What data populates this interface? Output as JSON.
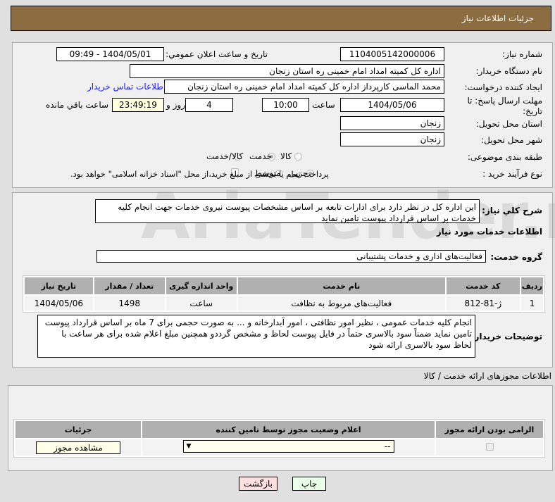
{
  "header": {
    "title": "جزئیات اطلاعات نیاز"
  },
  "watermark": "AriaTender.net",
  "info": {
    "need_number_label": "شماره نیاز:",
    "need_number": "1104005142000006",
    "announce_label": "تاریخ و ساعت اعلان عمومي:",
    "announce_value": "1404/05/01 - 09:49",
    "buyer_label": "نام دستگاه خریدار:",
    "buyer_value": "اداره کل کمیته امداد امام خمینی  ره  استان زنجان",
    "creator_label": "ایجاد کننده درخواست:",
    "creator_value": "محمد الماسی کارپرداز اداره کل کمیته امداد امام خمینی  ره  استان زنجان",
    "contact_link": "اطلاعات تماس خریدار",
    "deadline_label": "مهلت ارسال پاسخ: تا تاریخ:",
    "deadline_date": "1404/05/06",
    "time_label": "ساعت",
    "deadline_time": "10:00",
    "days": "4",
    "days_label": "روز و",
    "remaining": "23:49:19",
    "remaining_label": "ساعت باقي مانده",
    "province_label": "استان محل تحویل:",
    "province": "زنجان",
    "city_label": "شهر محل تحویل:",
    "city": "زنجان",
    "category_label": "طبقه بندی موضوعی:",
    "category_options": [
      "کالا",
      "خدمت",
      "کالا/خدمت"
    ],
    "category_selected": "خدمت",
    "process_label": "نوع فرآیند خرید :",
    "process_options": [
      "جزیی",
      "متوسط"
    ],
    "process_selected": "جزیی",
    "payment_note": "پرداخت تمام یا بخشی از مبلغ خرید،از محل \"اسناد خزانه اسلامی\" خواهد بود."
  },
  "details": {
    "summary_label": "شرح کلي نیاز:",
    "summary": "این اداره کل در نظر دارد برای ادارات تابعه بر اساس مشخصات پیوست نیروی خدمات جهت انجام کلیه خدمات بر اساس قرارداد پیوست تامین نماید",
    "services_title": "اطلاعات خدمات مورد نیاز",
    "group_label": "گروه خدمت:",
    "group_value": "فعالیت‌های اداری و خدمات پشتیبانی",
    "table": {
      "headers": [
        "ردیف",
        "کد خدمت",
        "نام خدمت",
        "واحد اندازه گیری",
        "تعداد / مقدار",
        "تاریخ نیاز"
      ],
      "rows": [
        [
          "1",
          "ژ-81-812",
          "فعالیت‌های مربوط به نظافت",
          "ساعت",
          "1498",
          "1404/05/06"
        ]
      ]
    },
    "notes_label": "توضیحات خریدار:",
    "notes": "انجام کلیه خدمات عمومی ، نظیر امور نظافتی ، امور آبدارخانه و ... به صورت حجمی  برای 7 ماه بر اساس قرارداد پیوست تامین نماید ضمناً سود بالاسری حتماً در فایل پیوست لحاظ و مشخص گرددو همچنین مبلغ اعلام شده برای هر ساعت با لحاظ سود بالاسری ارائه شود"
  },
  "permits": {
    "title": "اطلاعات مجوزهای ارائه خدمت / کالا",
    "headers": [
      "الزامی بودن ارائه مجوز",
      "اعلام وضعیت مجوز توسط تامین کننده",
      "جزئیات"
    ],
    "select_value": "--",
    "view_button": "مشاهده مجوز"
  },
  "buttons": {
    "print": "چاپ",
    "back": "بازگشت"
  }
}
